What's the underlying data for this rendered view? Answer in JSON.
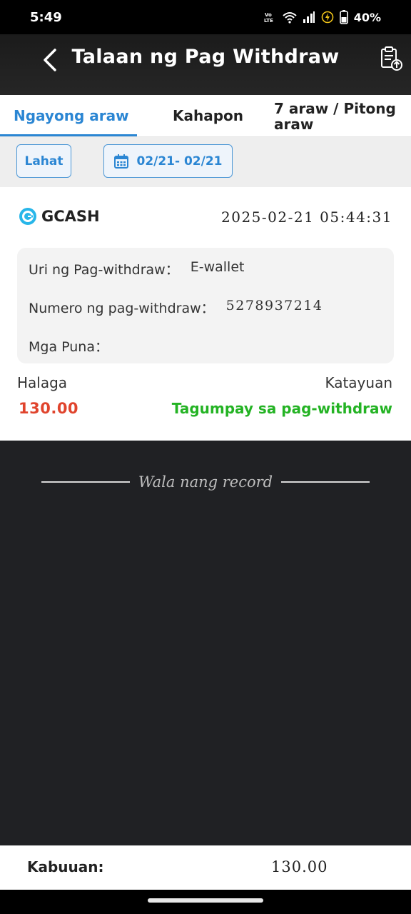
{
  "status_bar": {
    "time": "5:49",
    "volte": "Vo LTE",
    "battery": "40%"
  },
  "header": {
    "title": "Talaan ng Pag Withdraw"
  },
  "tabs": [
    {
      "label": "Ngayong araw",
      "active": true
    },
    {
      "label": "Kahapon",
      "active": false
    },
    {
      "label": "7 araw / Pitong araw",
      "active": false
    }
  ],
  "filters": {
    "all_label": "Lahat",
    "date_range": "02/21- 02/21"
  },
  "record": {
    "method": "GCASH",
    "datetime": "2025-02-21 05:44:31",
    "type_label": "Uri ng Pag-withdraw：",
    "type_value": "E-wallet",
    "number_label": "Numero ng pag-withdraw：",
    "number_value": "5278937214",
    "remarks_label": "Mga Puna：",
    "remarks_value": "",
    "amount_label": "Halaga",
    "amount_value": "130.00",
    "status_label": "Katayuan",
    "status_value": "Tagumpay sa pag-withdraw"
  },
  "list_end": "Wala nang record",
  "footer": {
    "total_label": "Kabuuan:",
    "total_value": "130.00"
  },
  "colors": {
    "accent": "#2b86d3",
    "amount": "#e0442d",
    "success": "#24b324",
    "gcash": "#27b6e9"
  }
}
